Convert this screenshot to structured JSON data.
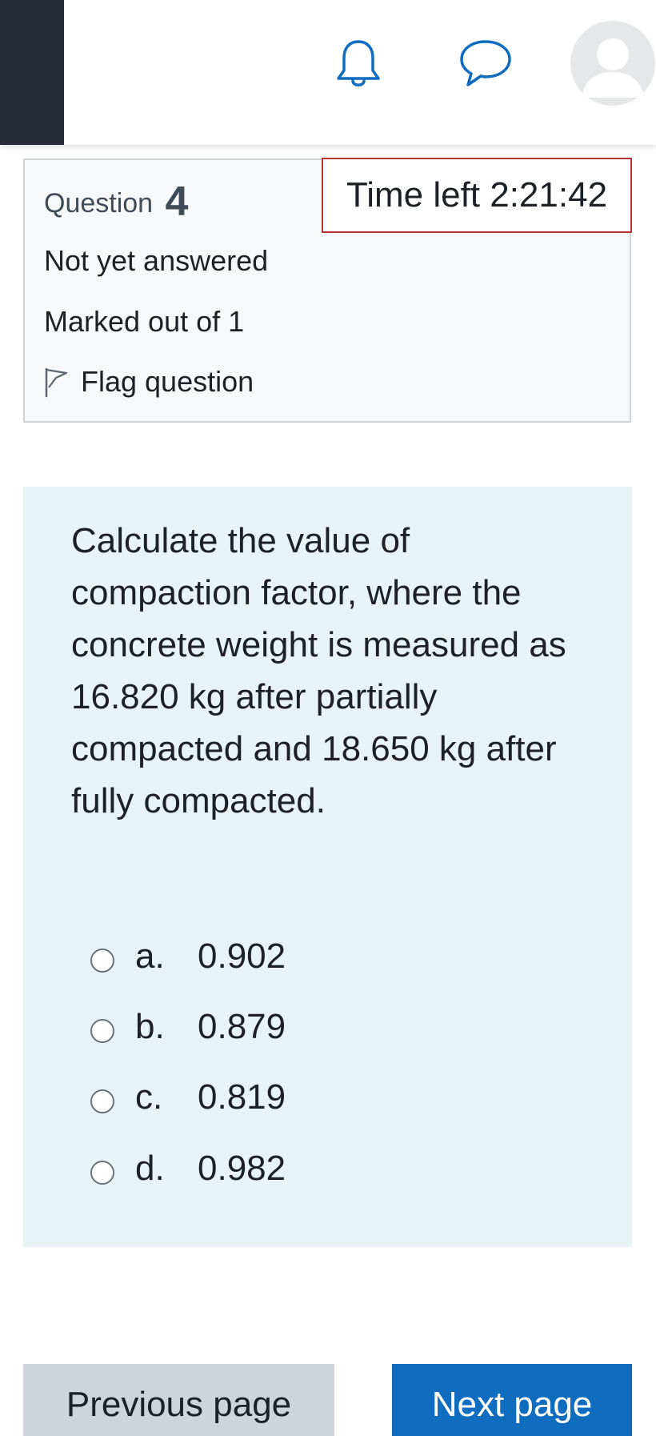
{
  "header": {
    "icons": [
      "bell-icon",
      "message-icon",
      "user-avatar"
    ]
  },
  "question_info": {
    "question_label": "Question",
    "question_number": "4",
    "state": "Not yet answered",
    "grade": "Marked out of 1",
    "flag_label": "Flag question"
  },
  "timer": {
    "text": "Time left 2:21:42"
  },
  "question": {
    "text": "Calculate the value of compaction factor, where the concrete weight is measured as 16.820 kg after partially compacted and 18.650 kg after fully compacted.",
    "answers": [
      {
        "letter": "a.",
        "value": "0.902"
      },
      {
        "letter": "b.",
        "value": "0.879"
      },
      {
        "letter": "c.",
        "value": "0.819"
      },
      {
        "letter": "d.",
        "value": "0.982"
      }
    ]
  },
  "navigation": {
    "prev_label": "Previous page",
    "next_label": "Next page"
  },
  "colors": {
    "accent": "#0f6cbf",
    "timer_border": "#b4372d",
    "question_bg": "#e7f3f5",
    "drawer": "#262a33"
  }
}
